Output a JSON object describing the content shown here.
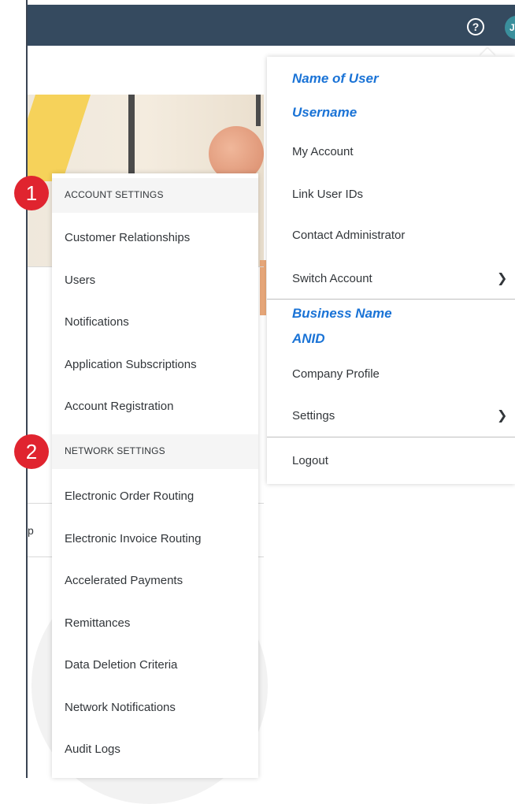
{
  "topbar": {
    "help_icon": "question-circle-icon",
    "avatar_initials": "JW"
  },
  "background": {
    "peek_text": "p"
  },
  "settings_menu": {
    "badges": [
      "1",
      "2"
    ],
    "sections": [
      {
        "header": "ACCOUNT SETTINGS",
        "items": [
          "Customer Relationships",
          "Users",
          "Notifications",
          "Application Subscriptions",
          "Account Registration"
        ]
      },
      {
        "header": "NETWORK SETTINGS",
        "items": [
          "Electronic Order Routing",
          "Electronic Invoice Routing",
          "Accelerated Payments",
          "Remittances",
          "Data Deletion Criteria",
          "Network Notifications",
          "Audit Logs"
        ]
      }
    ]
  },
  "user_menu": {
    "name_of_user": "Name of User",
    "username": "Username",
    "my_account": "My Account",
    "link_user_ids": "Link User IDs",
    "contact_administrator": "Contact Administrator",
    "switch_account": "Switch Account",
    "business_name": "Business Name",
    "anid": "ANID",
    "company_profile": "Company Profile",
    "settings": "Settings",
    "logout": "Logout",
    "chevron_icon": "chevron-right-icon"
  },
  "colors": {
    "topbar": "#354a5f",
    "avatar": "#3a8f9c",
    "badge": "#e0242f",
    "title_blue": "#1a73d6"
  }
}
